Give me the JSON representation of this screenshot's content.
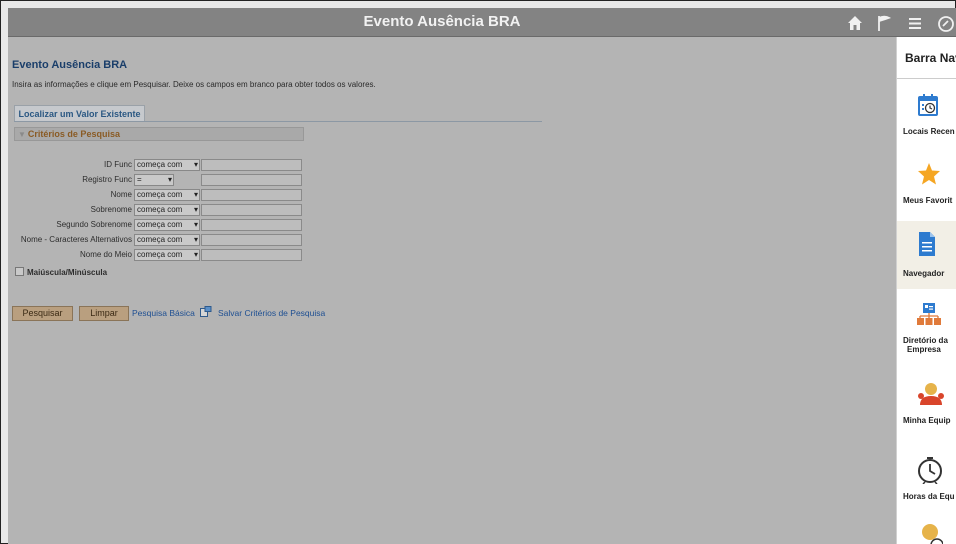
{
  "header": {
    "title": "Evento Ausência BRA",
    "icons": [
      "home-icon",
      "flag-icon",
      "menu-icon",
      "navbar-icon"
    ]
  },
  "page": {
    "corner_letter": "N",
    "title": "Evento Ausência BRA",
    "instructions": "Insira as informações e clique em Pesquisar. Deixe os campos em branco para obter todos os valores.",
    "tab_label": "Localizar um Valor Existente",
    "section_label": "Critérios de Pesquisa",
    "fields": [
      {
        "label": "ID Func",
        "operator": "começa com",
        "value": ""
      },
      {
        "label": "Registro Func",
        "operator": "=",
        "value": ""
      },
      {
        "label": "Nome",
        "operator": "começa com",
        "value": ""
      },
      {
        "label": "Sobrenome",
        "operator": "começa com",
        "value": ""
      },
      {
        "label": "Segundo Sobrenome",
        "operator": "começa com",
        "value": ""
      },
      {
        "label": "Nome - Caracteres Alternativos",
        "operator": "começa com",
        "value": ""
      },
      {
        "label": "Nome do Meio",
        "operator": "começa com",
        "value": ""
      }
    ],
    "case_checkbox_label": "Maiúscula/Minúscula",
    "search_button": "Pesquisar",
    "clear_button": "Limpar",
    "basic_search_link": "Pesquisa Básica",
    "save_criteria_link": "Salvar Critérios de Pesquisa"
  },
  "navbar": {
    "title": "Barra Nav",
    "items": [
      {
        "label": "Locais Recen",
        "icon": "calendar-clock-icon"
      },
      {
        "label": "Meus Favorit",
        "icon": "star-icon"
      },
      {
        "label": "Navegador",
        "icon": "document-icon"
      },
      {
        "label": "Diretório da",
        "label2": "Empresa",
        "icon": "org-chart-icon"
      },
      {
        "label": "Minha Equip",
        "icon": "team-icon"
      },
      {
        "label": "Horas da Equ",
        "icon": "clock-icon"
      }
    ]
  },
  "colors": {
    "banner": "#838383",
    "link": "#1e4f92",
    "section_text": "#8a5b24",
    "star": "#f5a623",
    "doc": "#2e7bcf"
  }
}
